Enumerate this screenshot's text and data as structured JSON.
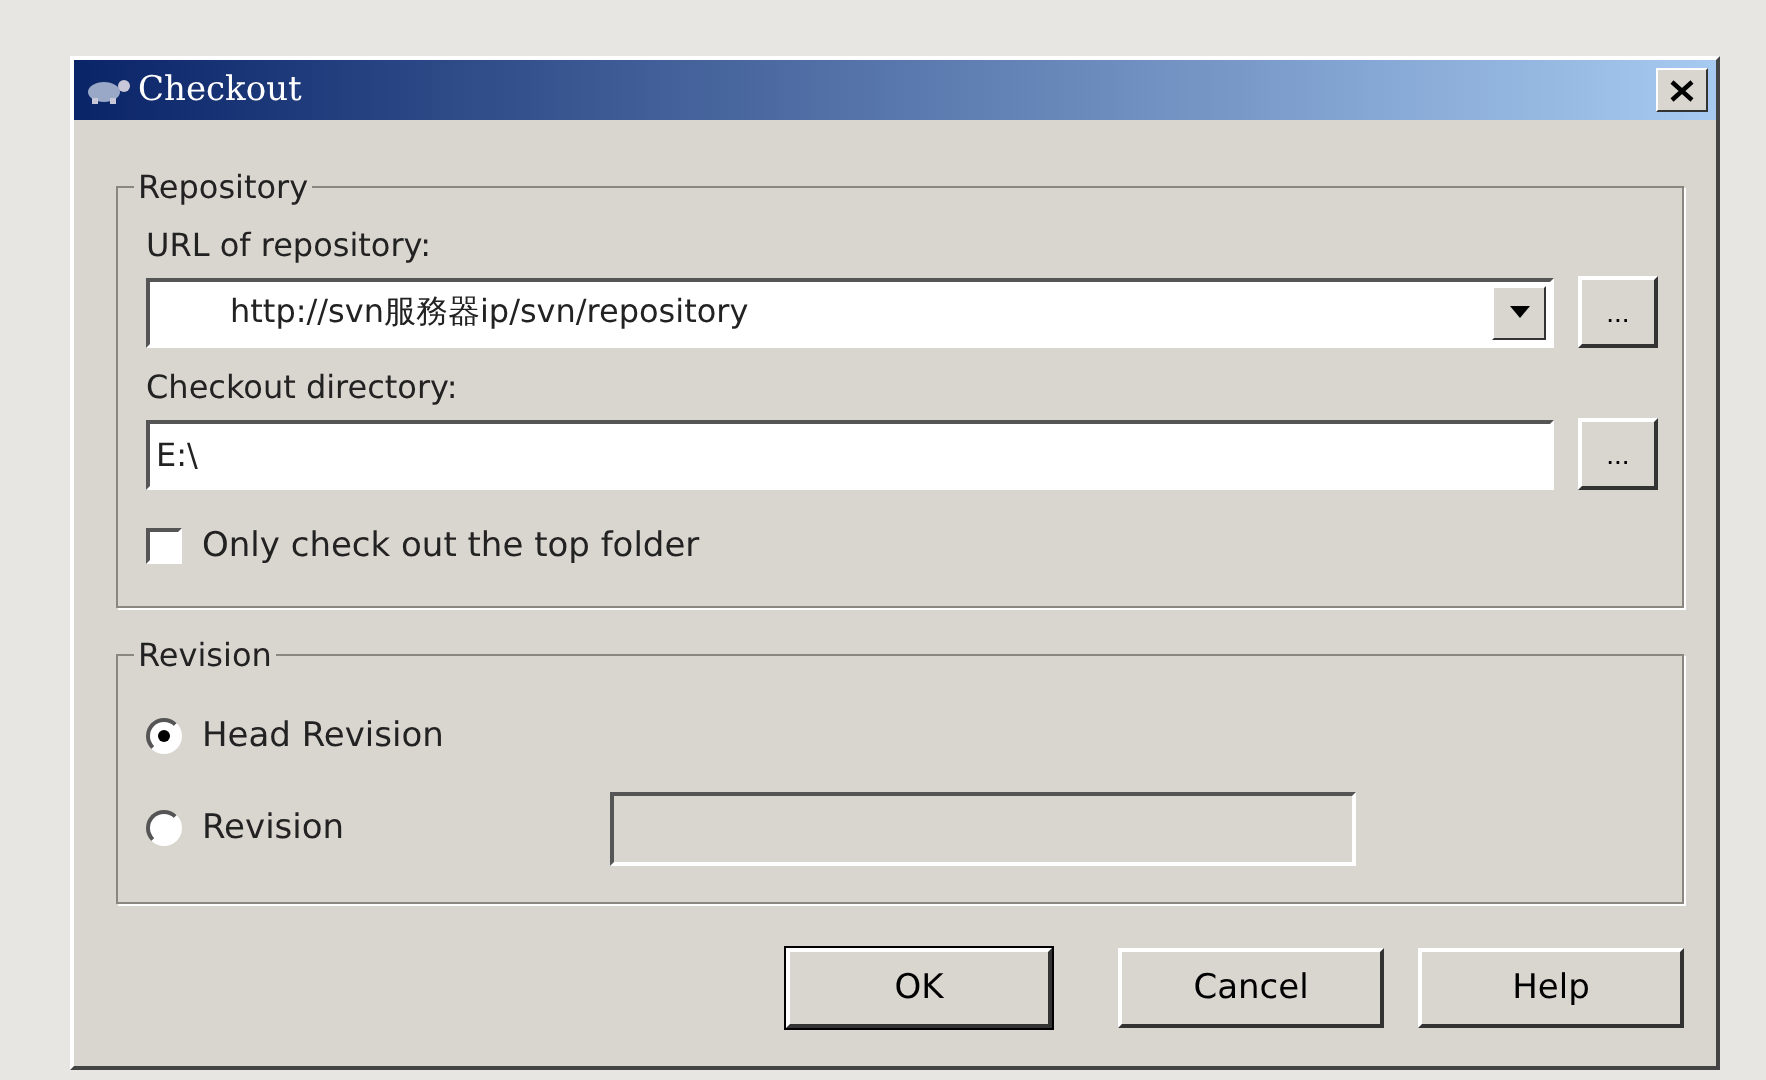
{
  "window": {
    "title": "Checkout"
  },
  "repository": {
    "title": "Repository",
    "url_label": "URL of repository:",
    "url_value": "http://svn服務器ip/svn/repository",
    "url_browse": "...",
    "dir_label": "Checkout directory:",
    "dir_value": "E:\\",
    "dir_browse": "...",
    "top_folder": {
      "label": "Only check out the top folder",
      "checked": false
    }
  },
  "revision": {
    "title": "Revision",
    "options": [
      {
        "label": "Head Revision",
        "selected": true
      },
      {
        "label": "Revision",
        "selected": false
      }
    ]
  },
  "buttons": [
    {
      "label": "OK",
      "default": true
    },
    {
      "label": "Cancel",
      "default": false
    },
    {
      "label": "Help",
      "default": false
    }
  ]
}
